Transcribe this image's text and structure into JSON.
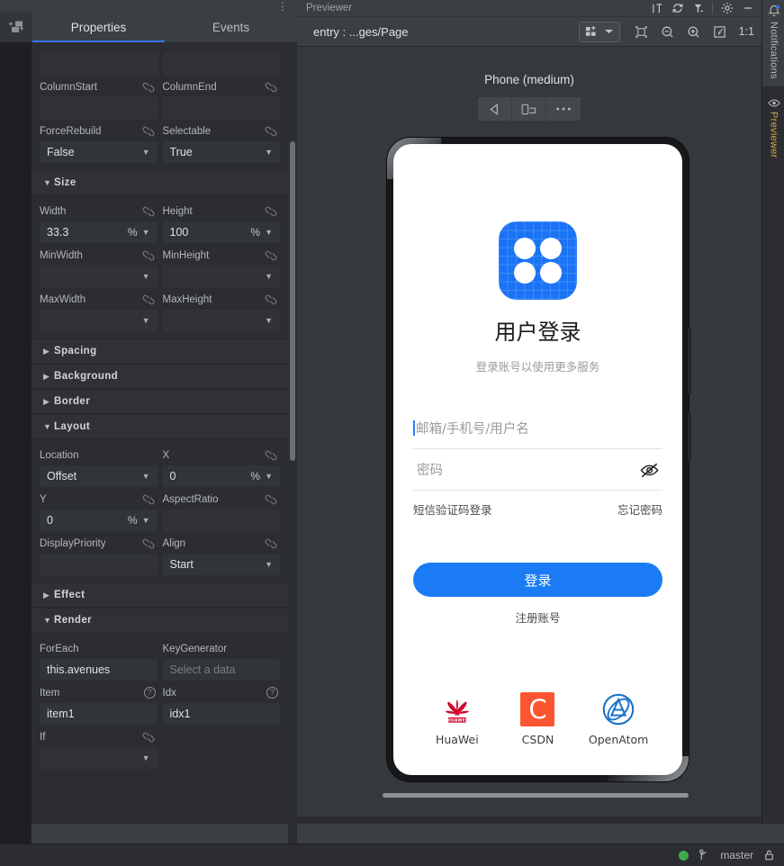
{
  "left_panel": {
    "tabs": [
      {
        "label": "Properties",
        "active": true
      },
      {
        "label": "Events",
        "active": false
      }
    ],
    "kebab_glyph": "⋮",
    "tab_icon_name": "component-add-icon",
    "sections": [
      {
        "id": "top_partial",
        "type": "fields",
        "fields": [
          {
            "label": "ColumnStart",
            "value": "",
            "unit": "",
            "chevron": false,
            "link": true,
            "placeholder": ""
          },
          {
            "label": "ColumnEnd",
            "value": "",
            "unit": "",
            "chevron": false,
            "link": true,
            "placeholder": ""
          },
          {
            "label": "ForceRebuild",
            "value": "False",
            "unit": "",
            "chevron": true,
            "link": true,
            "placeholder": ""
          },
          {
            "label": "Selectable",
            "value": "True",
            "unit": "",
            "chevron": true,
            "link": true,
            "placeholder": ""
          }
        ]
      },
      {
        "id": "size",
        "type": "group",
        "title": "Size",
        "expanded": true,
        "fields": [
          {
            "label": "Width",
            "value": "33.3",
            "unit": "%",
            "chevron": true,
            "link": true,
            "placeholder": ""
          },
          {
            "label": "Height",
            "value": "100",
            "unit": "%",
            "chevron": true,
            "link": true,
            "placeholder": ""
          },
          {
            "label": "MinWidth",
            "value": "",
            "unit": "",
            "chevron": true,
            "link": true,
            "placeholder": ""
          },
          {
            "label": "MinHeight",
            "value": "",
            "unit": "",
            "chevron": true,
            "link": true,
            "placeholder": ""
          },
          {
            "label": "MaxWidth",
            "value": "",
            "unit": "",
            "chevron": true,
            "link": true,
            "placeholder": ""
          },
          {
            "label": "MaxHeight",
            "value": "",
            "unit": "",
            "chevron": true,
            "link": true,
            "placeholder": ""
          }
        ]
      },
      {
        "id": "spacing",
        "type": "group",
        "title": "Spacing",
        "expanded": false,
        "fields": []
      },
      {
        "id": "background",
        "type": "group",
        "title": "Background",
        "expanded": false,
        "fields": []
      },
      {
        "id": "border",
        "type": "group",
        "title": "Border",
        "expanded": false,
        "fields": []
      },
      {
        "id": "layout",
        "type": "group",
        "title": "Layout",
        "expanded": true,
        "fields": [
          {
            "label": "Location",
            "value": "Offset",
            "unit": "",
            "chevron": true,
            "link": false,
            "placeholder": ""
          },
          {
            "label": "X",
            "value": "0",
            "unit": "%",
            "chevron": true,
            "link": true,
            "placeholder": ""
          },
          {
            "label": "Y",
            "value": "0",
            "unit": "%",
            "chevron": true,
            "link": true,
            "placeholder": ""
          },
          {
            "label": "AspectRatio",
            "value": "",
            "unit": "",
            "chevron": false,
            "link": true,
            "placeholder": ""
          },
          {
            "label": "DisplayPriority",
            "value": "",
            "unit": "",
            "chevron": false,
            "link": true,
            "placeholder": ""
          },
          {
            "label": "Align",
            "value": "Start",
            "unit": "",
            "chevron": true,
            "link": true,
            "placeholder": ""
          }
        ]
      },
      {
        "id": "effect",
        "type": "group",
        "title": "Effect",
        "expanded": false,
        "fields": []
      },
      {
        "id": "render",
        "type": "group",
        "title": "Render",
        "expanded": true,
        "fields": [
          {
            "label": "ForEach",
            "value": "this.avenues",
            "unit": "",
            "chevron": false,
            "link": false,
            "placeholder": ""
          },
          {
            "label": "KeyGenerator",
            "value": "",
            "unit": "",
            "chevron": false,
            "link": false,
            "placeholder": "Select a data"
          },
          {
            "label": "Item",
            "value": "item1",
            "unit": "",
            "chevron": false,
            "link": false,
            "help": true,
            "placeholder": ""
          },
          {
            "label": "Idx",
            "value": "idx1",
            "unit": "",
            "chevron": false,
            "link": false,
            "help": true,
            "placeholder": ""
          },
          {
            "label": "If",
            "value": "",
            "unit": "",
            "chevron": true,
            "link": true,
            "placeholder": ""
          }
        ]
      }
    ]
  },
  "previewer": {
    "window_title": "Previewer",
    "title_icons": [
      "text-size-icon",
      "refresh-icon",
      "inspector-icon",
      "settings-gear-icon",
      "minimize-icon"
    ],
    "path": "entry : ...ges/Page",
    "toolbar_icons": [
      "multi-device-grid-icon",
      "chevron-down-icon",
      "select-frame-icon",
      "zoom-out-icon",
      "zoom-in-icon",
      "fit-screen-icon"
    ],
    "zoom_ratio": "1:1",
    "device_label": "Phone (medium)",
    "device_buttons": [
      "back-arrow-icon",
      "rotate-device-icon",
      "more-options-icon"
    ]
  },
  "app_screen": {
    "logo_name": "app-logo-grid-icon",
    "logo_color": "#1a73f5",
    "title": "用户登录",
    "subtitle": "登录账号以使用更多服务",
    "username_placeholder": "邮箱/手机号/用户名",
    "username_value": "",
    "password_placeholder": "密码",
    "password_value": "",
    "eye_icon": "eye-off-icon",
    "link_left": "短信验证码登录",
    "link_right": "忘记密码",
    "login_button": "登录",
    "login_button_color": "#1a7bf5",
    "register_link": "注册账号",
    "brands": [
      {
        "name": "HuaWei",
        "icon": "huawei-logo-icon",
        "color": "#cf0a2c"
      },
      {
        "name": "CSDN",
        "icon": "csdn-logo-icon",
        "color": "#fc5531",
        "letter": "C"
      },
      {
        "name": "OpenAtom",
        "icon": "openatom-logo-icon",
        "color": "#1a73c8"
      }
    ]
  },
  "right_rail": {
    "items": [
      {
        "label": "Notifications",
        "icon": "bell-icon",
        "active": true
      },
      {
        "label": "Previewer",
        "icon": "eye-icon",
        "active": false
      }
    ]
  },
  "status_bar": {
    "indicator_color": "#3fa84a",
    "branch_icon": "git-branch-icon",
    "branch": "master",
    "lock_icon": "lock-icon"
  }
}
